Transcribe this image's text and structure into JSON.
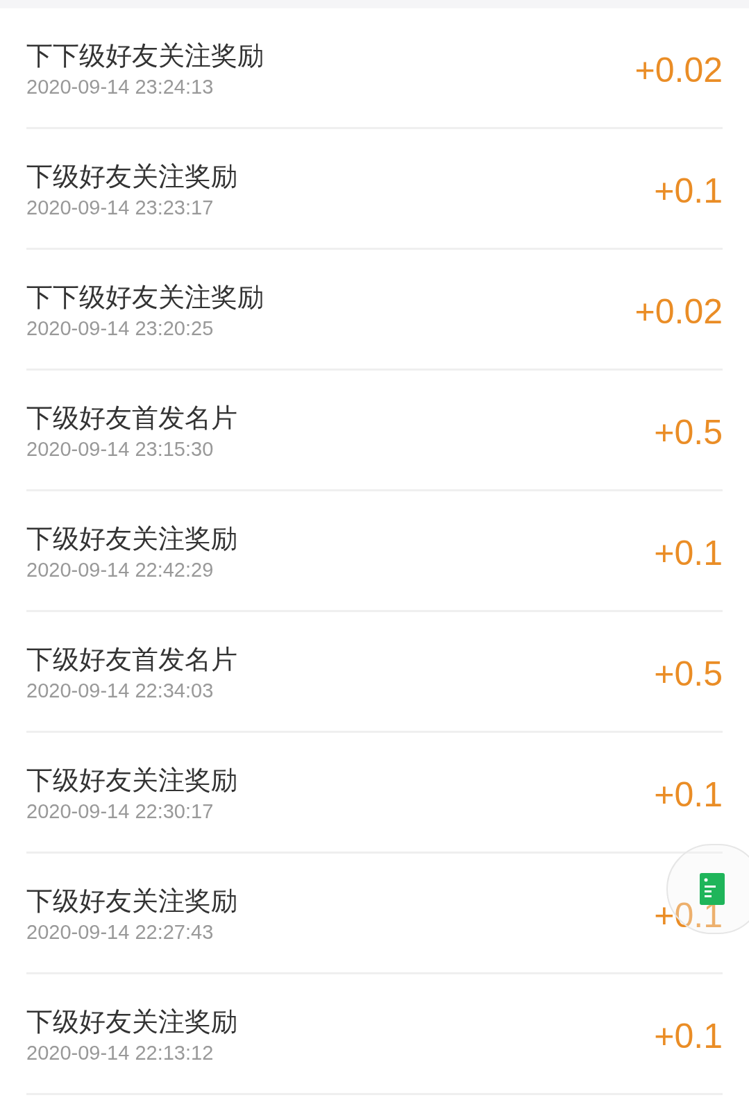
{
  "records": [
    {
      "title": "下下级好友关注奖励",
      "time": "2020-09-14 23:24:13",
      "amount": "+0.02"
    },
    {
      "title": "下级好友关注奖励",
      "time": "2020-09-14 23:23:17",
      "amount": "+0.1"
    },
    {
      "title": "下下级好友关注奖励",
      "time": "2020-09-14 23:20:25",
      "amount": "+0.02"
    },
    {
      "title": "下级好友首发名片",
      "time": "2020-09-14 23:15:30",
      "amount": "+0.5"
    },
    {
      "title": "下级好友关注奖励",
      "time": "2020-09-14 22:42:29",
      "amount": "+0.1"
    },
    {
      "title": "下级好友首发名片",
      "time": "2020-09-14 22:34:03",
      "amount": "+0.5"
    },
    {
      "title": "下级好友关注奖励",
      "time": "2020-09-14 22:30:17",
      "amount": "+0.1"
    },
    {
      "title": "下级好友关注奖励",
      "time": "2020-09-14 22:27:43",
      "amount": "+0.1"
    },
    {
      "title": "下级好友关注奖励",
      "time": "2020-09-14 22:13:12",
      "amount": "+0.1"
    }
  ]
}
